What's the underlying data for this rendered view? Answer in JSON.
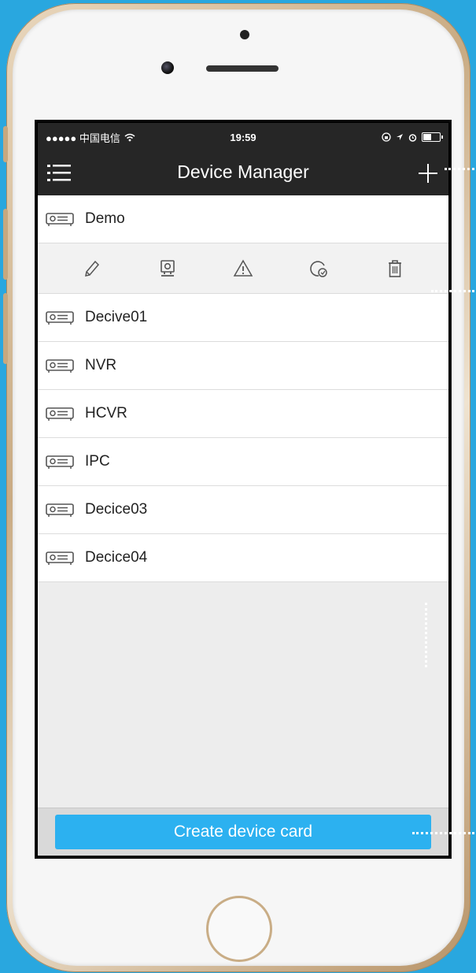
{
  "status_bar": {
    "carrier": "●●●●● 中国电信",
    "time": "19:59"
  },
  "nav": {
    "title": "Device Manager"
  },
  "devices": [
    {
      "name": "Demo",
      "expanded": true
    },
    {
      "name": "Decive01"
    },
    {
      "name": "NVR"
    },
    {
      "name": "HCVR"
    },
    {
      "name": "IPC"
    },
    {
      "name": "Decice03"
    },
    {
      "name": "Decice04"
    }
  ],
  "actions": [
    "edit-icon",
    "camera-icon",
    "warning-icon",
    "refresh-icon",
    "trash-icon"
  ],
  "create_button": {
    "label": "Create device card"
  },
  "colors": {
    "background": "#29a7df",
    "bar": "#262626",
    "accent": "#2cb1f0"
  }
}
